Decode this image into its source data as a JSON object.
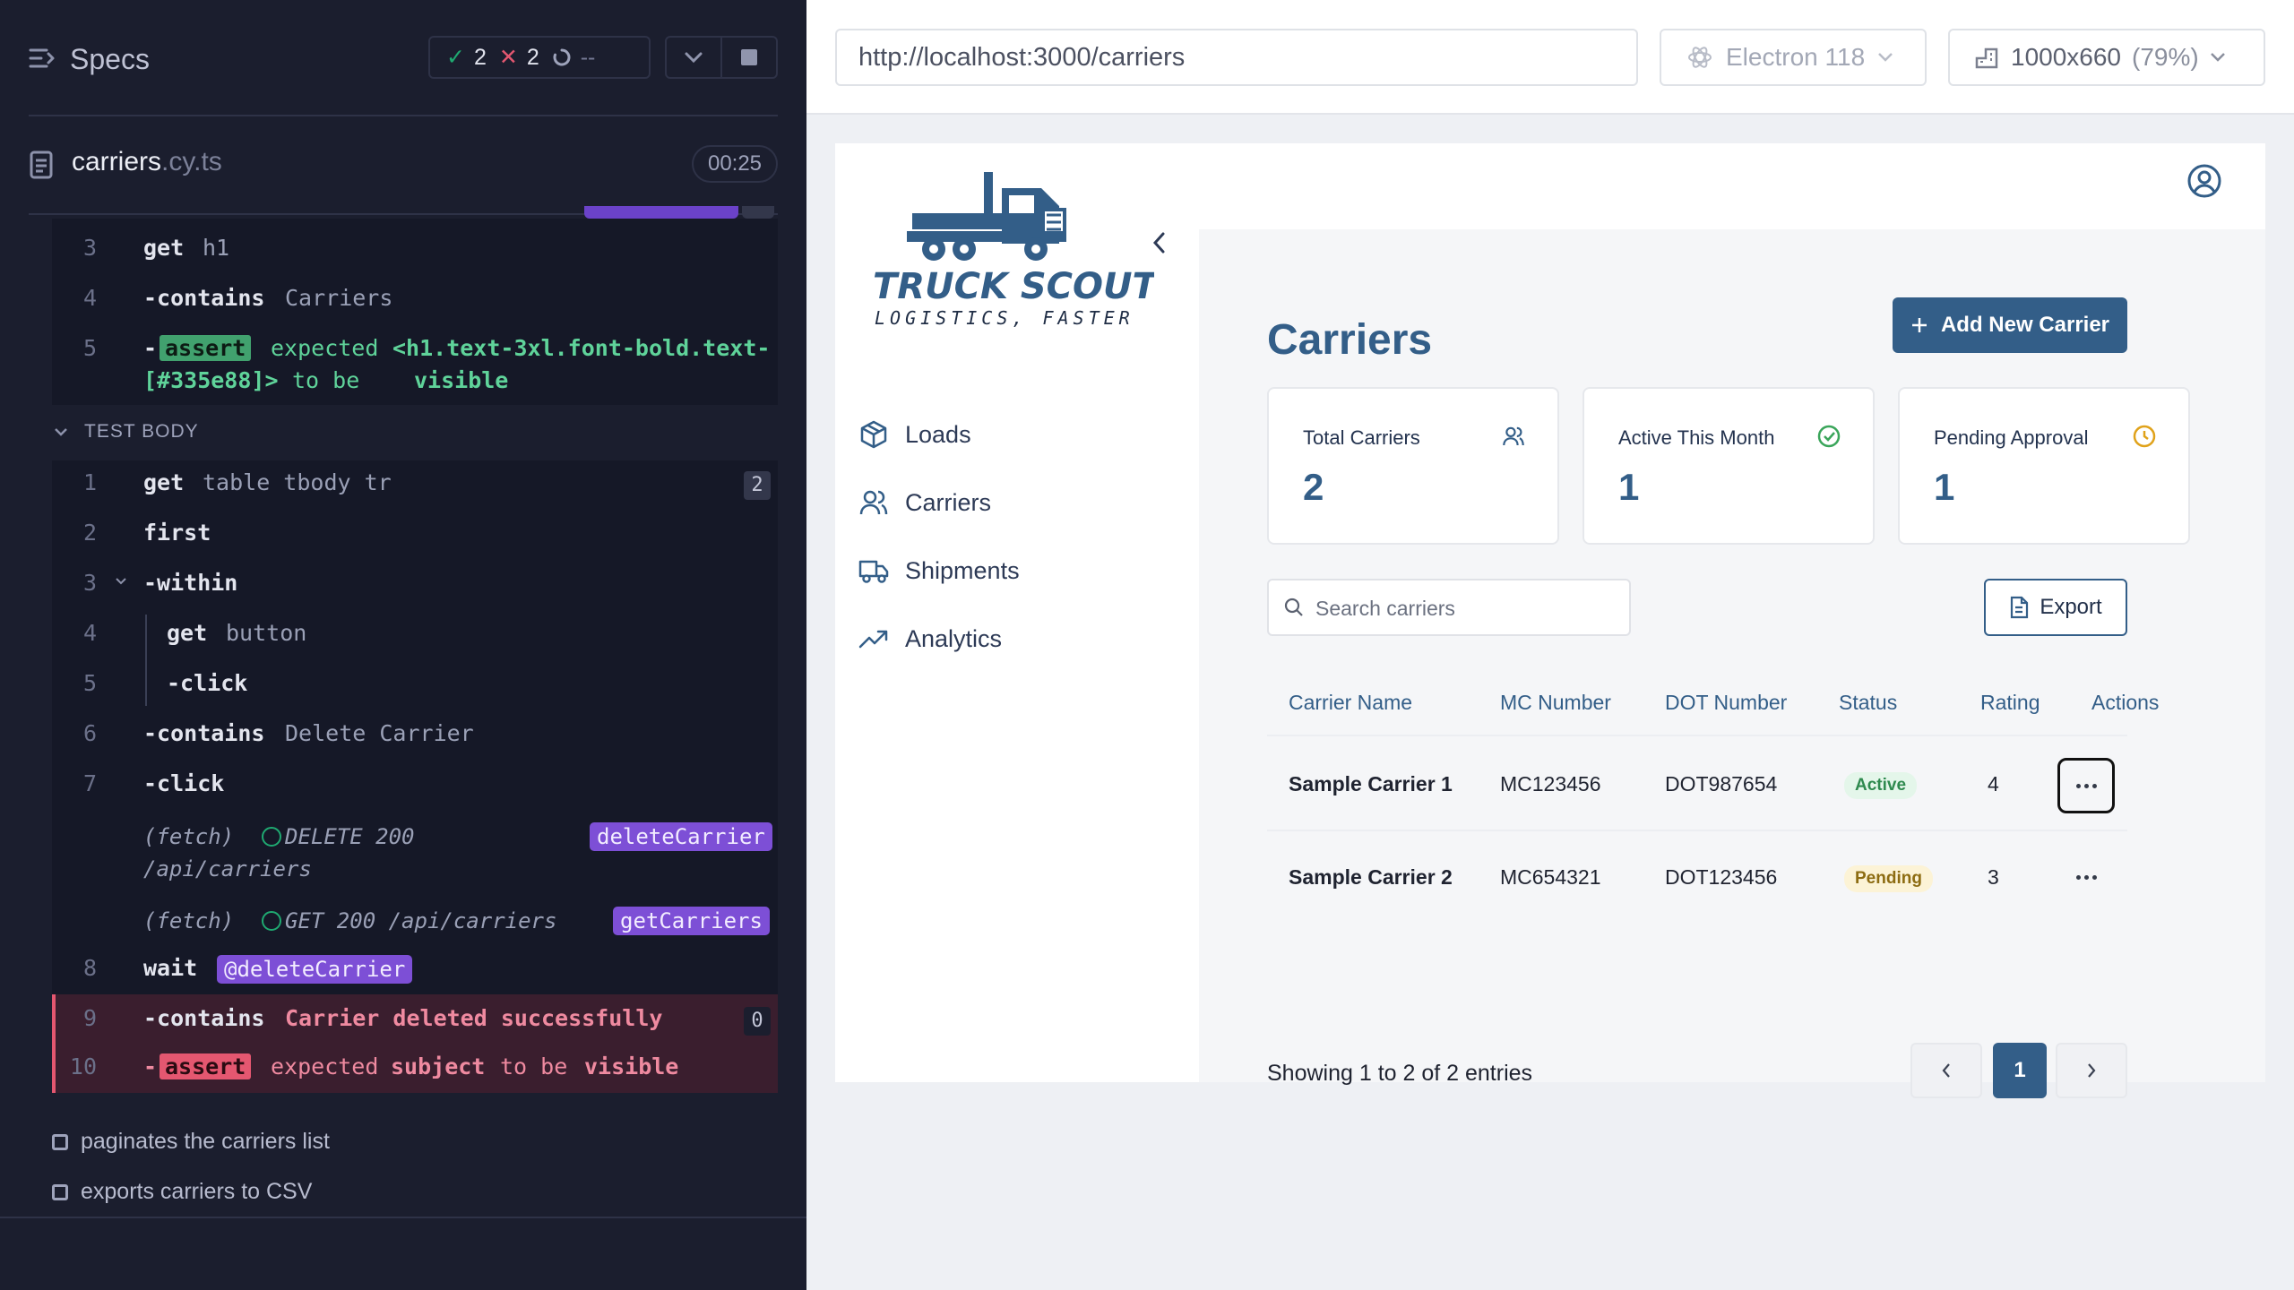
{
  "runner": {
    "specs_label": "Specs",
    "passed": "2",
    "failed": "2",
    "pending": "--",
    "file_name": "carriers",
    "file_ext": ".cy.ts",
    "timer": "00:25",
    "before": [
      {
        "ln": "3",
        "name": "get",
        "arg": "h1"
      },
      {
        "ln": "4",
        "name": "-contains",
        "arg": "Carriers"
      }
    ],
    "assert_top": {
      "ln": "5",
      "badge": "assert",
      "line1_a": "expected",
      "line1_b": "<h1.text-3xl.font-bold.text-",
      "line2_a": "[#335e88]>",
      "line2_b": "to be",
      "line2_c": "visible"
    },
    "section_label": "TEST BODY",
    "body": [
      {
        "ln": "1",
        "name": "get",
        "arg": "table tbody tr",
        "count": "2"
      },
      {
        "ln": "2",
        "name": "first",
        "arg": ""
      },
      {
        "ln": "3",
        "name": "-within",
        "arg": ""
      },
      {
        "ln": "4",
        "name": "get",
        "arg": "button"
      },
      {
        "ln": "5",
        "name": "-click",
        "arg": ""
      },
      {
        "ln": "6",
        "name": "-contains",
        "arg": "Delete Carrier"
      },
      {
        "ln": "7",
        "name": "-click",
        "arg": ""
      }
    ],
    "fetch1": {
      "type": "(fetch)",
      "req": "DELETE 200",
      "path": "/api/carriers",
      "alias": "deleteCarrier"
    },
    "fetch2": {
      "type": "(fetch)",
      "req": "GET 200 /api/carriers",
      "alias": "getCarriers"
    },
    "wait": {
      "ln": "8",
      "name": "wait",
      "alias": "@deleteCarrier"
    },
    "fail1": {
      "ln": "9",
      "name": "-contains",
      "arg": "Carrier deleted successfully",
      "count": "0"
    },
    "fail2": {
      "ln": "10",
      "badge": "assert",
      "a": "expected",
      "b": "subject",
      "c": "to be",
      "d": "visible"
    },
    "todos": [
      "paginates the carriers list",
      "exports carriers to CSV"
    ]
  },
  "browser": {
    "url": "http://localhost:3000/carriers",
    "engine": "Electron 118",
    "viewport": "1000x660",
    "zoom": "(79%)"
  },
  "app": {
    "logo_title": "TRUCK SCOUT",
    "logo_tagline": "LOGISTICS, FASTER",
    "nav": [
      {
        "label": "Loads",
        "icon": "box-icon"
      },
      {
        "label": "Carriers",
        "icon": "users-icon"
      },
      {
        "label": "Shipments",
        "icon": "truck-icon"
      },
      {
        "label": "Analytics",
        "icon": "trending-icon"
      }
    ],
    "title": "Carriers",
    "add_button": "Add New Carrier",
    "stats": [
      {
        "label": "Total Carriers",
        "value": "2",
        "icon": "users-icon",
        "color": "#335e88"
      },
      {
        "label": "Active This Month",
        "value": "1",
        "icon": "check-circle-icon",
        "color": "#3aa55a"
      },
      {
        "label": "Pending Approval",
        "value": "1",
        "icon": "clock-icon",
        "color": "#e0a21a"
      }
    ],
    "search_placeholder": "Search carriers",
    "export_label": "Export",
    "columns": [
      "Carrier Name",
      "MC Number",
      "DOT Number",
      "Status",
      "Rating",
      "Actions"
    ],
    "rows": [
      {
        "name": "Sample Carrier 1",
        "mc": "MC123456",
        "dot": "DOT987654",
        "status": "Active",
        "rating": "4"
      },
      {
        "name": "Sample Carrier 2",
        "mc": "MC654321",
        "dot": "DOT123456",
        "status": "Pending",
        "rating": "3"
      }
    ],
    "showing": "Showing 1 to 2 of 2 entries",
    "page": "1"
  }
}
